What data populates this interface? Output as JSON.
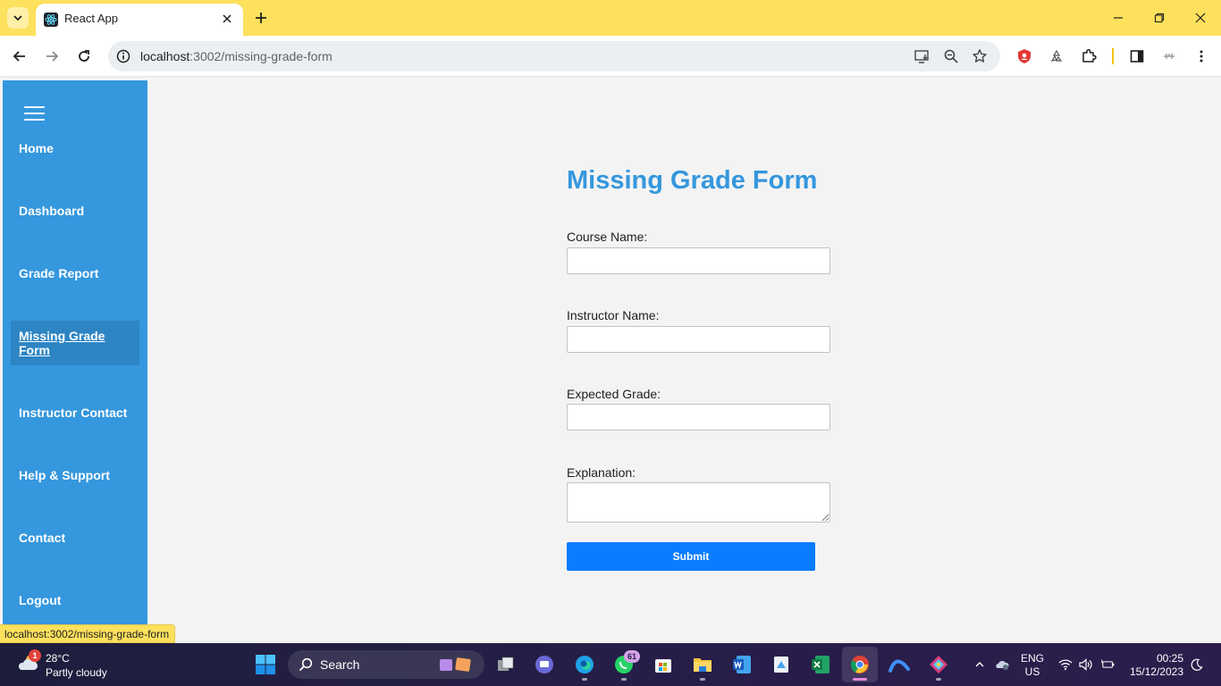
{
  "browser": {
    "tab_title": "React App",
    "url_host": "localhost",
    "url_rest": ":3002/missing-grade-form",
    "status_url": "localhost:3002/missing-grade-form"
  },
  "sidebar": {
    "items": [
      {
        "label": "Home"
      },
      {
        "label": "Dashboard"
      },
      {
        "label": "Grade Report"
      },
      {
        "label": "Missing Grade Form",
        "active": true
      },
      {
        "label": "Instructor Contact"
      },
      {
        "label": "Help & Support"
      },
      {
        "label": "Contact"
      },
      {
        "label": "Logout"
      }
    ]
  },
  "form": {
    "title": "Missing Grade Form",
    "course_label": "Course Name:",
    "course_value": "",
    "instructor_label": "Instructor Name:",
    "instructor_value": "",
    "grade_label": "Expected Grade:",
    "grade_value": "",
    "explanation_label": "Explanation:",
    "explanation_value": "",
    "submit_label": "Submit"
  },
  "taskbar": {
    "weather_badge": "1",
    "temperature": "28°C",
    "weather": "Partly cloudy",
    "search_label": "Search",
    "whatsapp_badge": "61",
    "lang_primary": "ENG",
    "lang_secondary": "US",
    "time": "00:25",
    "date": "15/12/2023"
  },
  "colors": {
    "sidebar": "#3597dd",
    "sidebar_active": "#2d85c4",
    "title": "#3597dd",
    "submit": "#0a7cff",
    "browser_frame": "#fde05c"
  }
}
